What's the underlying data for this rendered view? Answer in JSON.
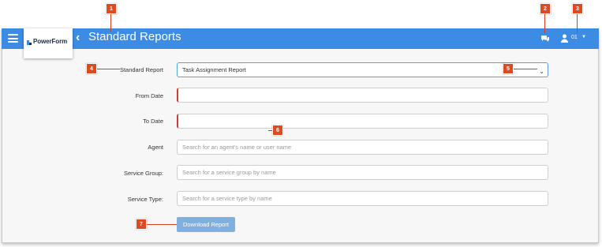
{
  "header": {
    "logo_text": "PowerForm",
    "title": "Standard Reports",
    "user_label": "01"
  },
  "form": {
    "standard_report_label": "Standard Report",
    "standard_report_value": "Task Assignment Report",
    "from_date_label": "From Date",
    "to_date_label": "To Date",
    "agent_label": "Agent",
    "agent_placeholder": "Search for an agent's name or user name",
    "service_group_label": "Service Group:",
    "service_group_placeholder": "Search for a service group by name",
    "service_type_label": "Service Type:",
    "service_type_placeholder": "Search for a service type by name",
    "download_label": "Download Report"
  },
  "callouts": [
    "1",
    "2",
    "3",
    "4",
    "5",
    "6",
    "7"
  ],
  "colors": {
    "topbar": "#3c8ce6",
    "callout": "#e04a1f",
    "button": "#7fb0df"
  },
  "icons": [
    "menu-icon",
    "powerform-logo-icon",
    "chevron-left-icon",
    "chat-icon",
    "user-icon",
    "caret-down-icon"
  ]
}
